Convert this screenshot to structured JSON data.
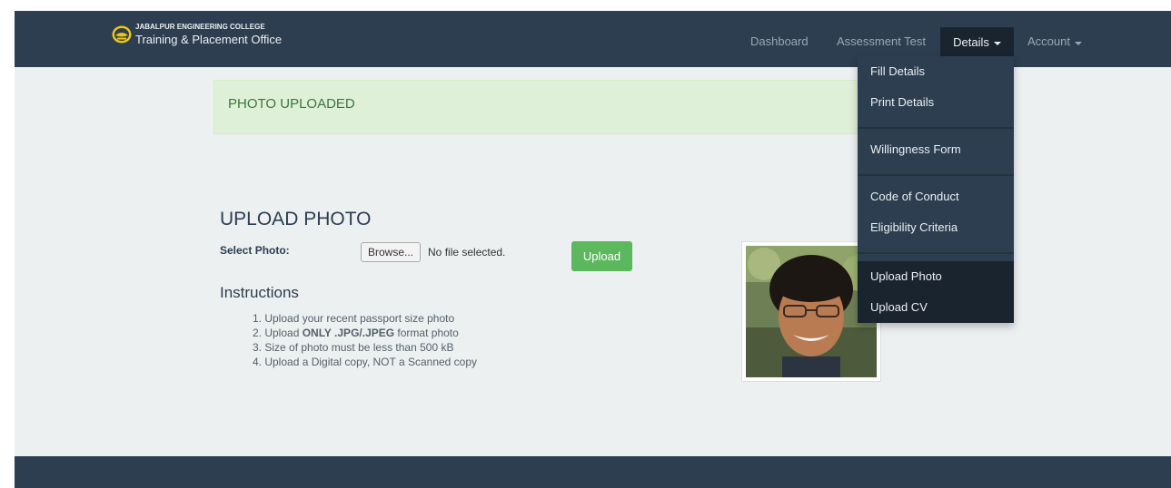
{
  "brand": {
    "line1": "JABALPUR ENGINEERING COLLEGE",
    "line2": "Training & Placement Office",
    "logo_icon": "college-crest-icon",
    "logo_color": "#f1c40f"
  },
  "nav": {
    "dashboard": "Dashboard",
    "assessment": "Assessment Test",
    "details": "Details",
    "account": "Account"
  },
  "dropdown": {
    "fill_details": "Fill Details",
    "print_details": "Print Details",
    "willingness_form": "Willingness Form",
    "code_of_conduct": "Code of Conduct",
    "eligibility_criteria": "Eligibility Criteria",
    "upload_photo": "Upload Photo",
    "upload_cv": "Upload CV"
  },
  "alert": {
    "message": "PHOTO UPLOADED"
  },
  "upload": {
    "title": "UPLOAD PHOTO",
    "select_label": "Select Photo:",
    "browse_label": "Browse...",
    "no_file": "No file selected.",
    "submit_label": "Upload"
  },
  "instructions": {
    "title": "Instructions",
    "item1": "1. Upload your recent passport size photo",
    "item2_prefix": "2. Upload ",
    "item2_bold": "ONLY .JPG/.JPEG",
    "item2_suffix": " format photo",
    "item3": "3. Size of photo must be less than 500 kB",
    "item4": "4. Upload a Digital copy, NOT a Scanned copy"
  },
  "colors": {
    "navbar": "#2c3e50",
    "page_bg": "#ecf0f1",
    "alert_bg": "#dff0d8",
    "alert_text": "#3c763d",
    "upload_button": "#5cb85c",
    "active_menu": "#1a242f"
  }
}
